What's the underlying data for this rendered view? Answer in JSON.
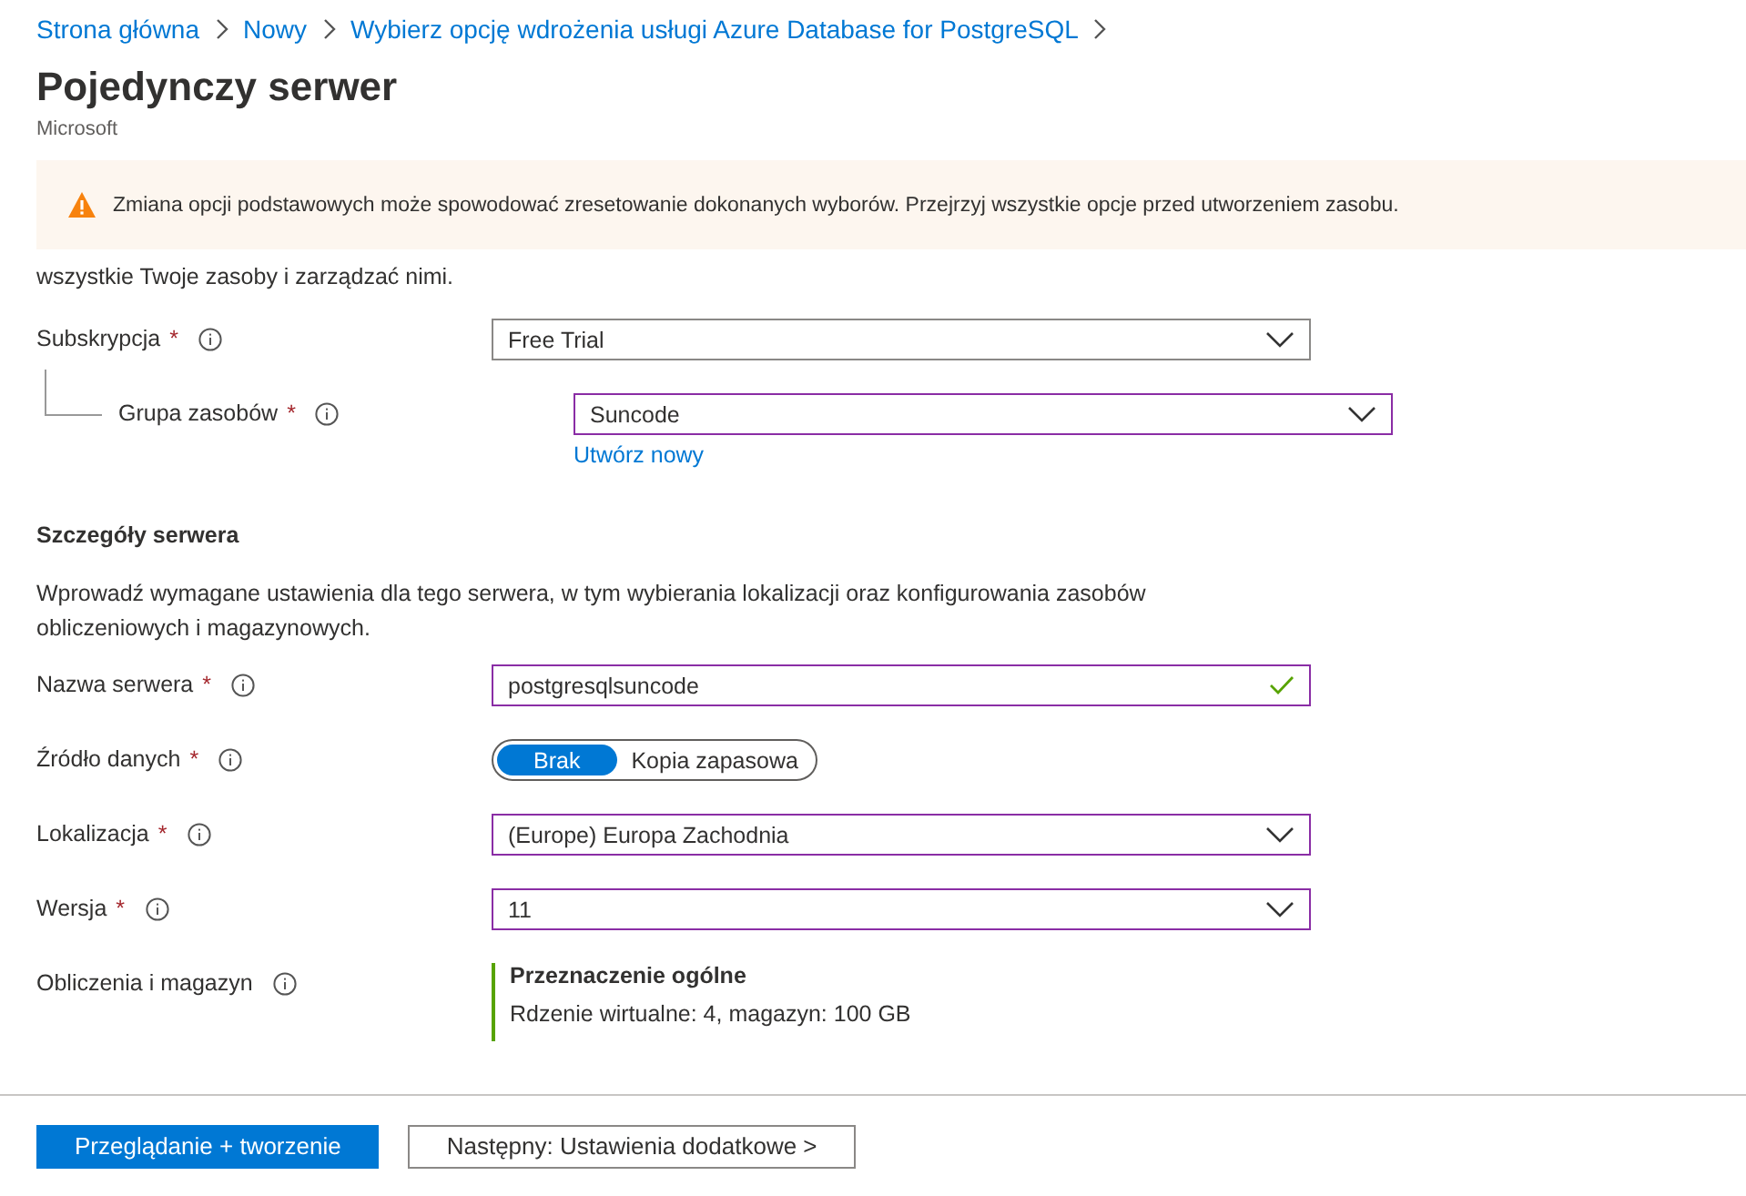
{
  "breadcrumb": [
    "Strona główna",
    "Nowy",
    "Wybierz opcję wdrożenia usługi Azure Database for PostgreSQL"
  ],
  "title": "Pojedynczy serwer",
  "publisher": "Microsoft",
  "warning": "Zmiana opcji podstawowych może spowodować zresetowanie dokonanych wyborów. Przejrzyj wszystkie opcje przed utworzeniem zasobu.",
  "intro": "wszystkie Twoje zasoby i zarządzać nimi.",
  "project_fields": [
    {
      "kind": "dropdown",
      "label": "Subskrypcja",
      "required": "*",
      "child": false,
      "highlighted": false,
      "value": "Free Trial"
    },
    {
      "kind": "dropdown",
      "label": "Grupa zasobów",
      "required": "*",
      "child": true,
      "highlighted": true,
      "value": "Suncode",
      "link": "Utwórz nowy"
    }
  ],
  "server_section": {
    "heading": "Szczegóły serwera",
    "description": "Wprowadź wymagane ustawienia dla tego serwera, w tym wybierania lokalizacji oraz konfigurowania zasobów obliczeniowych i magazynowych."
  },
  "server_fields": [
    {
      "kind": "text",
      "label": "Nazwa serwera",
      "required": "*",
      "highlighted": true,
      "value": "postgresqlsuncode",
      "valid": true
    },
    {
      "kind": "toggle",
      "label": "Źródło danych",
      "required": "*",
      "options": [
        {
          "label": "Brak",
          "selected": true
        },
        {
          "label": "Kopia zapasowa",
          "selected": false
        }
      ]
    },
    {
      "kind": "dropdown",
      "label": "Lokalizacja",
      "required": "*",
      "highlighted": true,
      "value": "(Europe) Europa Zachodnia"
    },
    {
      "kind": "dropdown",
      "label": "Wersja",
      "required": "*",
      "highlighted": true,
      "value": "11"
    },
    {
      "kind": "summary",
      "label": "Obliczenia i magazyn",
      "title": "Przeznaczenie ogólne",
      "detail": "Rdzenie wirtualne: 4, magazyn: 100 GB"
    }
  ],
  "buttons": [
    {
      "label": "Przeglądanie + tworzenie",
      "primary": true
    },
    {
      "label": "Następny: Ustawienia dodatkowe >",
      "primary": false
    }
  ]
}
